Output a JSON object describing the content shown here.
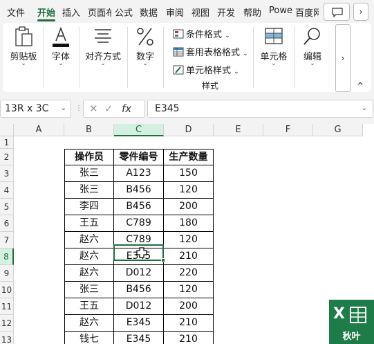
{
  "tabs": [
    "文件",
    "开始",
    "插入",
    "页面布",
    "公式",
    "数据",
    "审阅",
    "视图",
    "开发",
    "帮助",
    "Powe",
    "百度网"
  ],
  "active_tab": "开始",
  "ribbon": {
    "clipboard_label": "剪贴板",
    "font_label": "字体",
    "align_label": "对齐方式",
    "number_label": "数字",
    "cond_format_label": "条件格式",
    "table_format_label": "套用表格格式",
    "cell_style_label": "单元格样式",
    "styles_group_label": "样式",
    "cells_label": "单元格",
    "edit_label": "编辑",
    "scroll_label": "›",
    "collapse_label": "^"
  },
  "formula_bar": {
    "name_box": "13R x 3C",
    "fx": "fx",
    "formula": "E345"
  },
  "columns": [
    "A",
    "B",
    "C",
    "D",
    "E",
    "F",
    "G"
  ],
  "rows": [
    "1",
    "2",
    "3",
    "4",
    "5",
    "6",
    "7",
    "8",
    "9",
    "10",
    "11",
    "12",
    "13"
  ],
  "selected_cell": {
    "col": "C",
    "row": "8"
  },
  "table": {
    "headers": [
      "操作员",
      "零件编号",
      "生产数量"
    ],
    "rows": [
      [
        "张三",
        "A123",
        "150"
      ],
      [
        "张三",
        "B456",
        "120"
      ],
      [
        "李四",
        "B456",
        "200"
      ],
      [
        "王五",
        "C789",
        "180"
      ],
      [
        "赵六",
        "C789",
        "120"
      ],
      [
        "赵六",
        "E345",
        "210"
      ],
      [
        "赵六",
        "D012",
        "220"
      ],
      [
        "张三",
        "B456",
        "120"
      ],
      [
        "王五",
        "D012",
        "200"
      ],
      [
        "赵六",
        "E345",
        "210"
      ],
      [
        "钱七",
        "E345",
        "210"
      ]
    ]
  },
  "watermark": {
    "letter": "X",
    "text": "秋叶"
  },
  "colors": {
    "accent": "#1e6e3e",
    "ribbon_bg": "#f3f3f3"
  }
}
